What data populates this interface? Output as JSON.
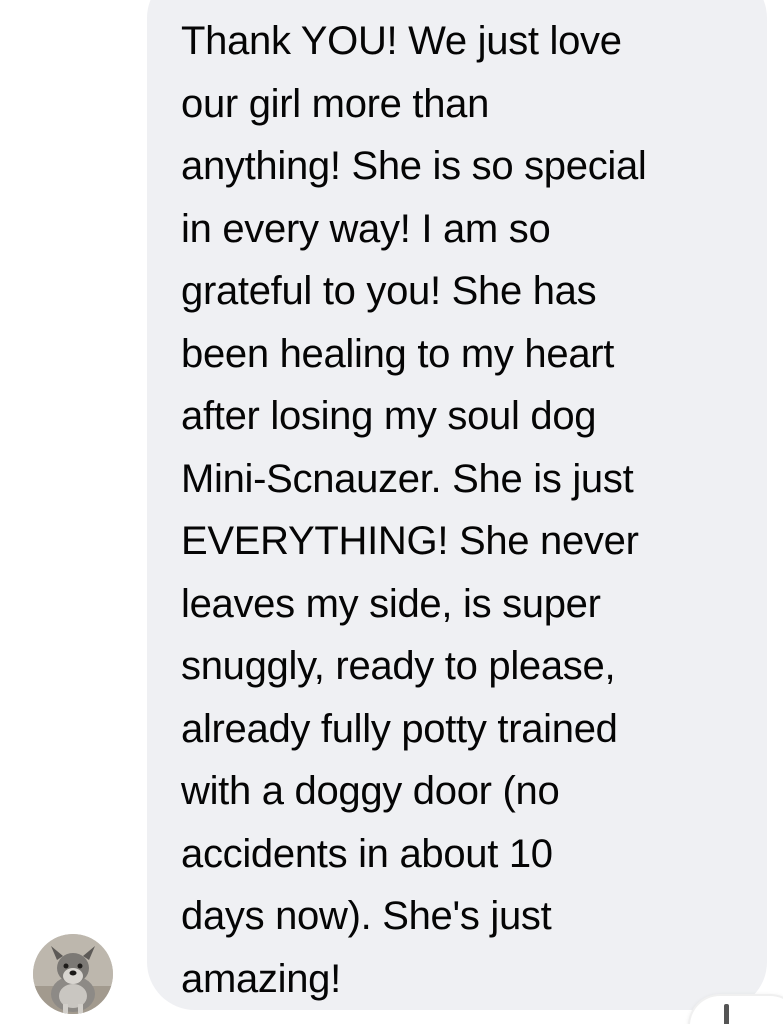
{
  "message": {
    "lines": [
      "Thank YOU! We just love",
      "our girl more than",
      "anything! She is so special",
      "in every way! I am so",
      "grateful to you! She has",
      "been healing to my heart",
      "after losing my soul dog",
      "Mini-Scnauzer. She is just",
      "EVERYTHING! She never",
      "leaves my side, is super",
      "snuggly, ready to please,",
      "already fully potty trained",
      "with a doggy door (no",
      "accidents in about 10",
      "days now). She's just",
      "amazing!"
    ]
  },
  "sender": {
    "avatar_icon": "dog-photo-avatar"
  },
  "colors": {
    "bubble": "#eff0f3",
    "text": "#050505",
    "background": "#ffffff"
  }
}
